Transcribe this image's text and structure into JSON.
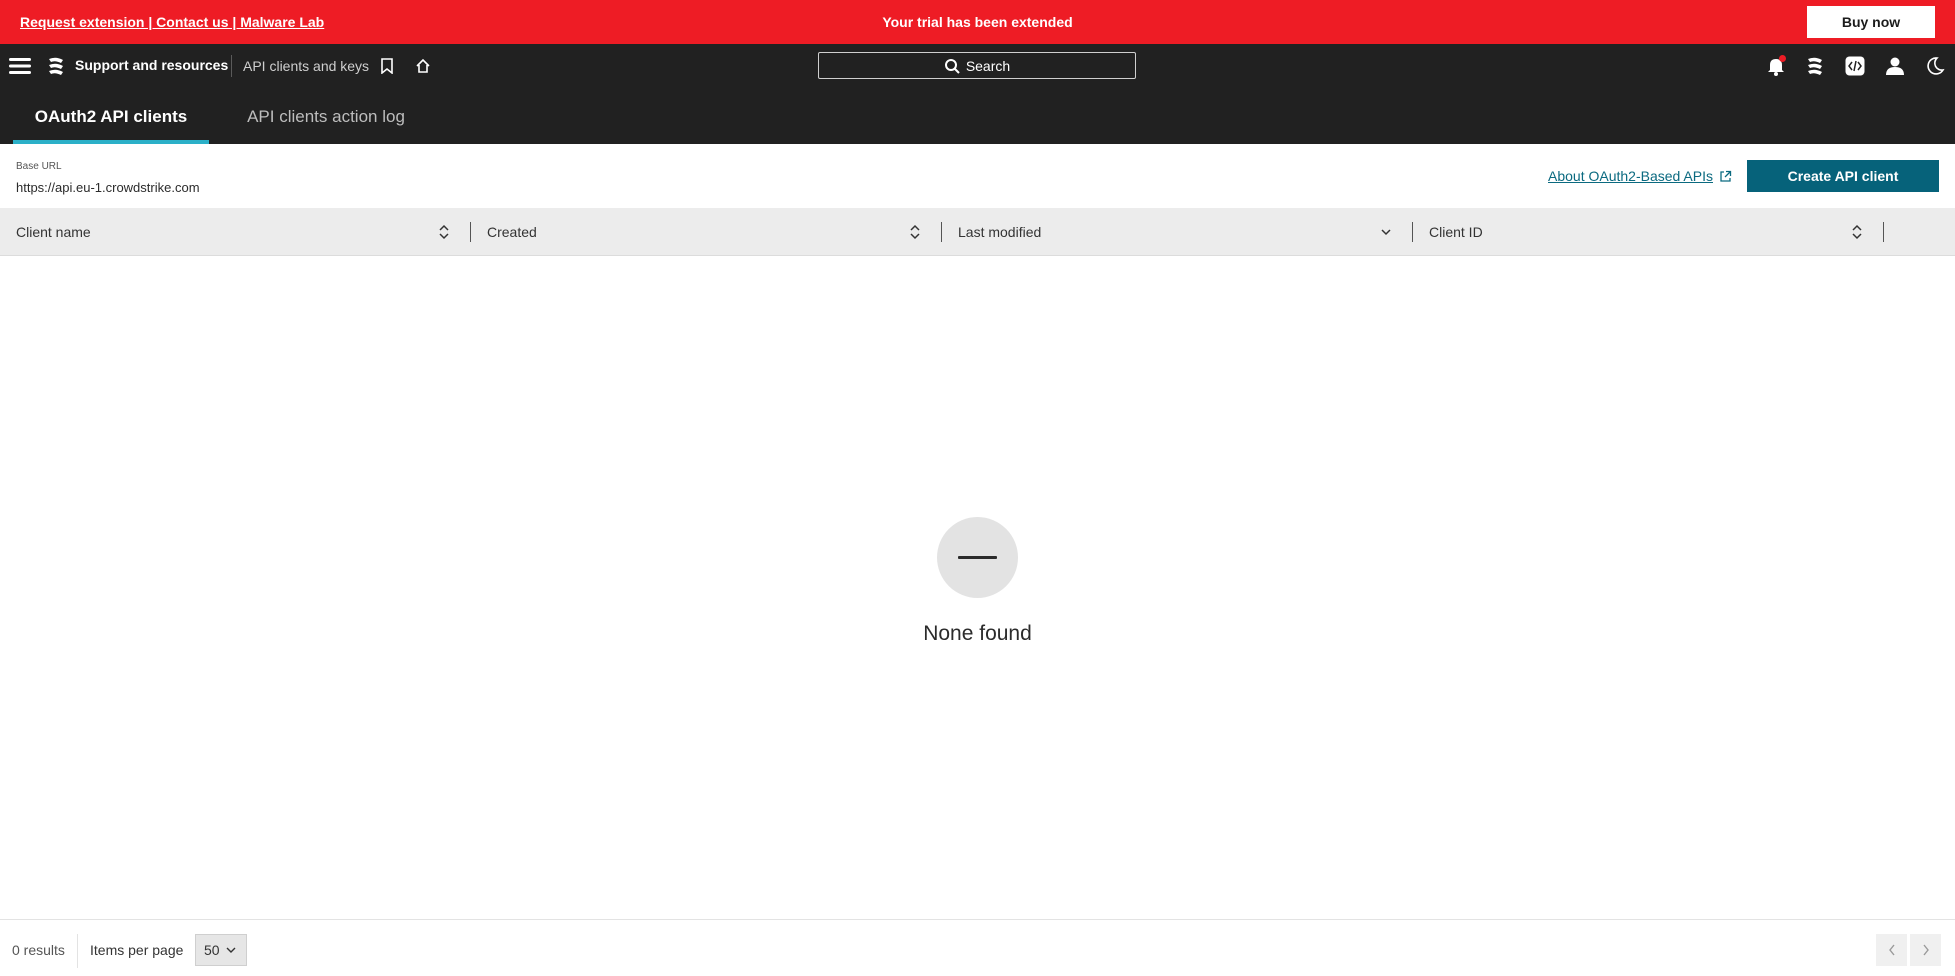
{
  "banner": {
    "links": "Request extension | Contact us | Malware Lab",
    "message": "Your trial has been extended",
    "buy_label": "Buy now",
    "color": "#ee1c25"
  },
  "topnav": {
    "menu_icon": "hamburger-menu-icon",
    "logo_icon": "crowdstrike-logo-icon",
    "app_title": "Support and resources",
    "breadcrumb": "API clients and keys",
    "search_label": "Search",
    "icons": [
      "bookmark-icon",
      "home-icon",
      "bell-icon",
      "crowdstrike-logo-icon",
      "code-icon",
      "user-icon",
      "moon-icon"
    ]
  },
  "tabs": [
    {
      "label": "OAuth2 API clients",
      "active": true
    },
    {
      "label": "API clients action log",
      "active": false
    }
  ],
  "base_url": {
    "label": "Base URL",
    "value": "https://api.eu-1.crowdstrike.com"
  },
  "about_link": "About OAuth2-Based APIs",
  "create_button": "Create API client",
  "table": {
    "columns": [
      {
        "label": "Client name",
        "sort": "both"
      },
      {
        "label": "Created",
        "sort": "both"
      },
      {
        "label": "Last modified",
        "sort": "descending"
      },
      {
        "label": "Client ID",
        "sort": "both"
      }
    ]
  },
  "empty_state": "None found",
  "footer": {
    "results": "0 results",
    "items_per_page_label": "Items per page",
    "items_per_page_value": "50"
  },
  "accent_color": "#06627a",
  "tab_underline_color": "#2bb0c8"
}
